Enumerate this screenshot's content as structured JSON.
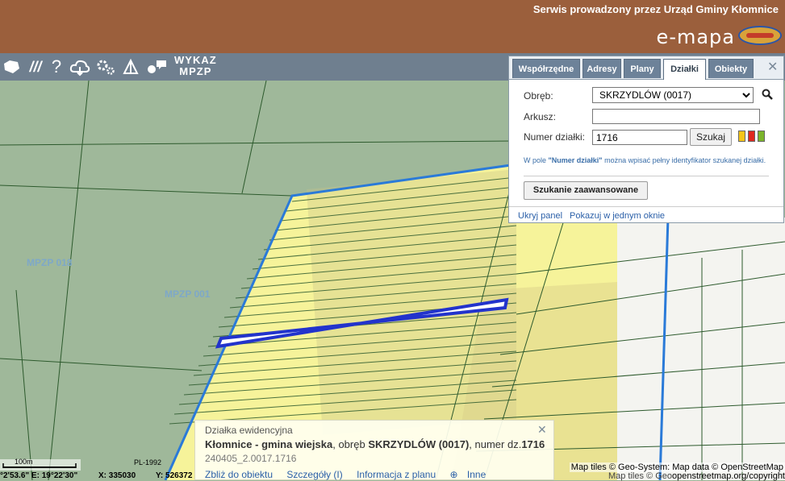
{
  "header": {
    "service_text": "Serwis prowadzony przez Urząd Gminy Kłomnice",
    "logo_text": "e-mapa",
    "logo_badge_text": "GEO-SYSTEM",
    "bg_color": "#9b5f3c"
  },
  "toolbar": {
    "icons": [
      "layers-icon",
      "lines-icon",
      "help-icon",
      "cloud-icon",
      "settings-icon",
      "measure-icon",
      "comment-icon"
    ],
    "help_glyph": "?",
    "lines_glyph": "///",
    "wykaz_label_line1": "WYKAZ",
    "wykaz_label_line2": "MPZP"
  },
  "map": {
    "labels": [
      "MPZP 018",
      "MPZP 001"
    ],
    "colors": {
      "background": "#9fb89a",
      "zone_yellow": "#f6f39a",
      "selected_parcel": "#2233cc",
      "boundary": "#2a7ad8",
      "line": "#2d5a2d"
    }
  },
  "panel": {
    "tabs": [
      "Współrzędne",
      "Adresy",
      "Plany",
      "Działki",
      "Obiekty"
    ],
    "active_tab": "Działki",
    "obreb_label": "Obręb:",
    "obreb_value": "SKRZYDLÓW (0017)",
    "arkusz_label": "Arkusz:",
    "arkusz_value": "",
    "numer_label": "Numer działki:",
    "numer_value": "1716",
    "search_button": "Szukaj",
    "hint_prefix": "W pole ",
    "hint_bold": "\"Numer działki\"",
    "hint_suffix": " można wpisać pełny identyfikator szukanej działki.",
    "advanced_button": "Szukanie zaawansowane",
    "hide_link": "Ukryj panel",
    "single_window_link": "Pokazuj w jednym oknie",
    "swatch_colors": [
      "#f5c518",
      "#e0281e",
      "#7bb42a"
    ]
  },
  "info": {
    "title": "Działka ewidencyjna",
    "gmina": "Kłomnice - gmina wiejska",
    "obreb_prefix": ", obręb ",
    "obreb": "SKRZYDLÓW (0017)",
    "numer_prefix": ", numer dz.",
    "numer": "1716",
    "identifier": "240405_2.0017.1716",
    "links": [
      "Zbliż do obiektu",
      "Szczegóły (I)",
      "Informacja z planu",
      "Inne"
    ]
  },
  "status": {
    "scale_label": "100m",
    "projection": "PL-1992",
    "coord_geo": "°2'53.6\"  E: 19°22'30\"",
    "coord_x": "X: 335030",
    "coord_y": "Y: 526372",
    "attribution_line1": "Map tiles © Geo-System: Map data © OpenStreetMap",
    "attribution_line2": "openstreetmap.org/copyright",
    "attribution_fragment": "Map tiles © Geo"
  }
}
